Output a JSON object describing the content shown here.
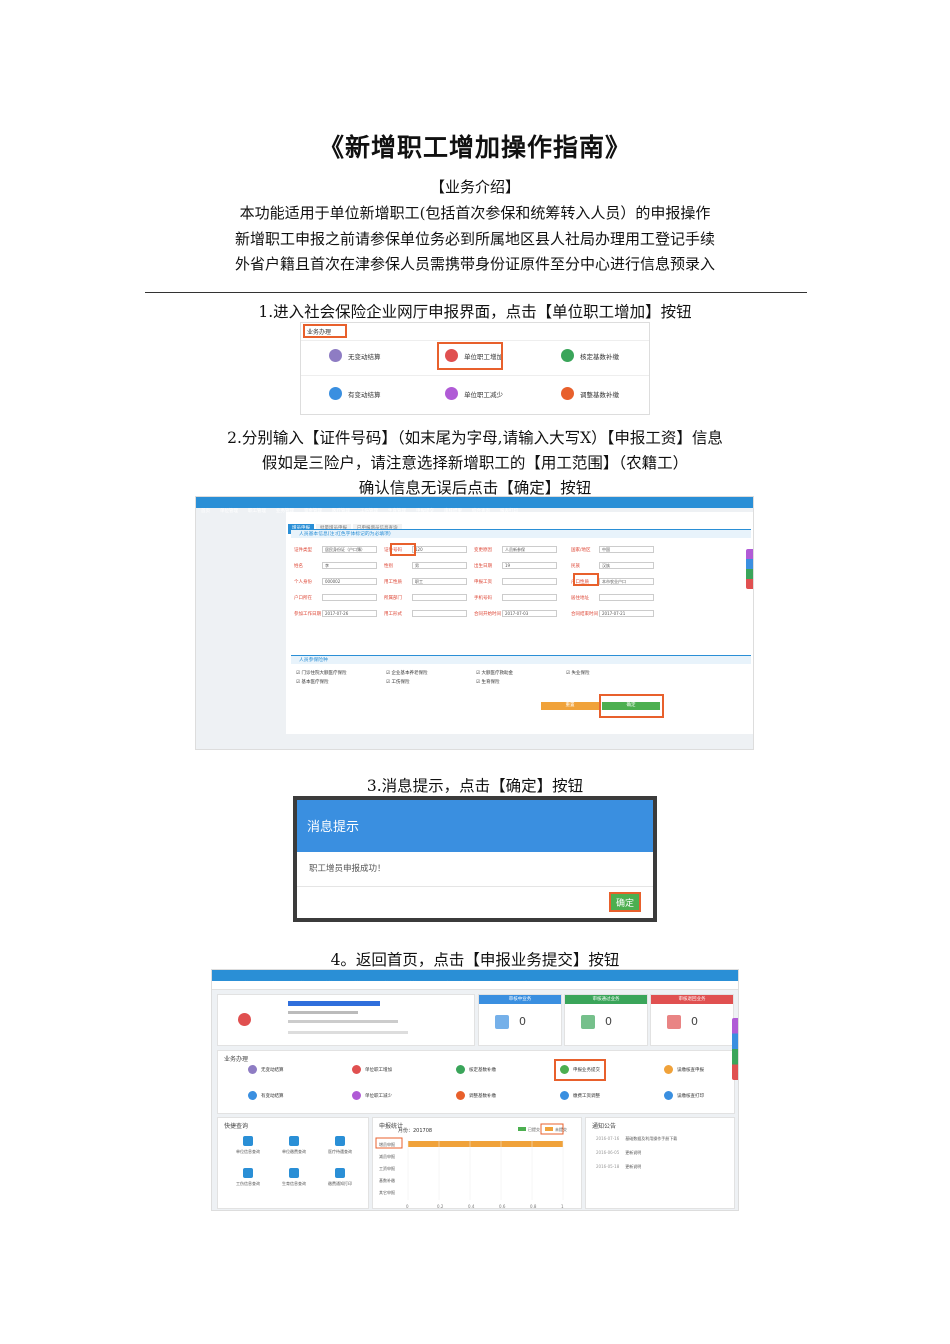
{
  "title": "《新增职工增加操作指南》",
  "intro": {
    "heading": "【业务介绍】",
    "lines": [
      "本功能适用于单位新增职工(包括首次参保和统筹转入人员）的申报操作",
      "新增职工申报之前请参保单位务必到所属地区县人社局办理用工登记手续",
      "外省户籍且首次在津参保人员需携带身份证原件至分中心进行信息预录入"
    ]
  },
  "steps": [
    {
      "text": "1.进入社会保险企业网厅申报界面，点击【单位职工增加】按钮"
    },
    {
      "lines": [
        "2.分别输入【证件号码】（如末尾为字母,请输入大写X）【申报工资】信息",
        "假如是三险户，请注意选择新增职工的【用工范围】（农籍工）",
        "确认信息无误后点击【确定】按钮"
      ]
    },
    {
      "text": "3.消息提示，点击【确定】按钮"
    },
    {
      "text": "4。返回首页，点击【申报业务提交】按钮"
    }
  ],
  "shot1": {
    "header": "业务办理",
    "tiles": [
      {
        "label": "无变动结算",
        "icon": "person-icon",
        "color": "#8e7cc3"
      },
      {
        "label": "单位职工增加",
        "icon": "add-user-icon",
        "color": "#e05050"
      },
      {
        "label": "核定基数补缴",
        "icon": "card-icon",
        "color": "#3aa55a"
      },
      {
        "label": "有变动结算",
        "icon": "calc-icon",
        "color": "#3a8fe0"
      },
      {
        "label": "单位职工减少",
        "icon": "remove-user-icon",
        "color": "#b05bd6"
      },
      {
        "label": "调整基数补缴",
        "icon": "adjust-icon",
        "color": "#e8602c"
      }
    ]
  },
  "shot2": {
    "nav": [
      "首页",
      "单位管理",
      "职工管理",
      "业务管理",
      "资金管理",
      "医疗管理",
      "工伤管理",
      "生育管理",
      "申报提交",
      "审核结果",
      "综合查询",
      "报表打印"
    ],
    "tabs": [
      "增员申报",
      "批量增员申报",
      "已申报增员信息查询"
    ],
    "section1": "人员基本信息(注:红色字体标记的为必填项)",
    "fields": [
      {
        "label": "证件类型",
        "value": "居民身份证（户口簿）"
      },
      {
        "label": "证件号码",
        "value": "120"
      },
      {
        "label": "变更原因",
        "value": "人员新参保"
      },
      {
        "label": "国家/地区",
        "value": "中国"
      },
      {
        "label": "姓名",
        "value": "李"
      },
      {
        "label": "性别",
        "value": "男"
      },
      {
        "label": "出生日期",
        "value": "19"
      },
      {
        "label": "民族",
        "value": "汉族"
      },
      {
        "label": "个人身份",
        "value": "000002"
      },
      {
        "label": "用工性质",
        "value": "职工"
      },
      {
        "label": "申报工资",
        "value": ""
      },
      {
        "label": "户口性质",
        "value": "本市农业户口"
      },
      {
        "label": "户口所在",
        "value": ""
      },
      {
        "label": "所属部门",
        "value": ""
      },
      {
        "label": "手机号码",
        "value": ""
      },
      {
        "label": "居住地址",
        "value": ""
      },
      {
        "label": "参加工作日期",
        "value": "2017-07-26"
      },
      {
        "label": "用工形式",
        "value": ""
      },
      {
        "label": "合同开始时间",
        "value": "2017-07-03"
      },
      {
        "label": "合同结束时间",
        "value": "2017-07-21"
      }
    ],
    "section2": "人员参保险种",
    "insurances": [
      "门诊住院大额医疗保险",
      "企业基本养老保险",
      "大额医疗救助金",
      "失业保险",
      "基本医疗保险",
      "工伤保险",
      "生育保险"
    ],
    "reset_label": "重置",
    "ok_label": "确定"
  },
  "shot3": {
    "title": "消息提示",
    "message": "职工增员申报成功！",
    "ok_label": "确定"
  },
  "shot4": {
    "cards": [
      {
        "label": "审核中业务",
        "value": "0",
        "color": "#3a8fe0"
      },
      {
        "label": "审核通过业务",
        "value": "0",
        "color": "#3aa55a"
      },
      {
        "label": "审核退回业务",
        "value": "0",
        "color": "#e05050"
      }
    ],
    "business_header": "业务办理",
    "tiles": [
      "无变动结算",
      "单位职工增加",
      "核定基数补缴",
      "申报业务提交",
      "误缴核查申报",
      "有变动结算",
      "单位职工减少",
      "调整基数补缴",
      "缴费工资调整",
      "误缴核查打印"
    ],
    "quick_header": "快捷查询",
    "quick": [
      "单位信息查询",
      "单位缴费查询",
      "医疗待遇查询",
      "工伤信息查询",
      "生育信息查询",
      "缴费通知打印"
    ],
    "stats_header": "申报统计",
    "period": "月份：201708",
    "legend": [
      "已提交",
      "未提交"
    ],
    "stats_rows": [
      "增员申报",
      "减员申报",
      "工资申报",
      "基数补缴",
      "其它申报"
    ],
    "x_ticks": [
      "0",
      "0.2",
      "0.4",
      "0.6",
      "0.8",
      "1"
    ],
    "bar_value": 1,
    "notice_header": "通知公告",
    "notices": [
      {
        "date": "2016-07-16",
        "text": "基础数据及利用操作手册下载"
      },
      {
        "date": "2016-06-05",
        "text": "更新说明"
      },
      {
        "date": "2016-05-18",
        "text": "更新说明"
      }
    ]
  }
}
